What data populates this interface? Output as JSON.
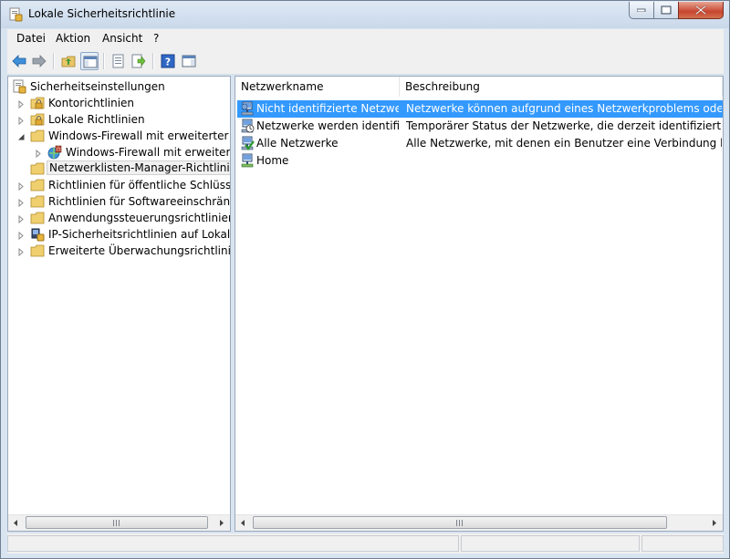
{
  "window": {
    "title": "Lokale Sicherheitsrichtlinie"
  },
  "menu": {
    "items": [
      "Datei",
      "Aktion",
      "Ansicht",
      "?"
    ]
  },
  "toolbar": {
    "icons": [
      "back-arrow-icon",
      "forward-arrow-icon",
      "up-folder-icon",
      "show-tree-icon",
      "properties-icon",
      "export-list-icon",
      "help-icon",
      "action-pane-icon"
    ]
  },
  "tree": {
    "root": "Sicherheitseinstellungen",
    "items": [
      {
        "label": "Kontorichtlinien",
        "icon": "folder-lock-icon"
      },
      {
        "label": "Lokale Richtlinien",
        "icon": "folder-lock-icon"
      },
      {
        "label": "Windows-Firewall mit erweiterter Sich",
        "icon": "folder-icon"
      },
      {
        "label": "Windows-Firewall mit erweiterter",
        "icon": "firewall-icon"
      },
      {
        "label": "Netzwerklisten-Manager-Richtlinien",
        "icon": "folder-icon"
      },
      {
        "label": "Richtlinien für öffentliche Schlüssel",
        "icon": "folder-icon"
      },
      {
        "label": "Richtlinien für Softwareeinschränkung",
        "icon": "folder-icon"
      },
      {
        "label": "Anwendungssteuerungsrichtlinien",
        "icon": "folder-icon"
      },
      {
        "label": "IP-Sicherheitsrichtlinien auf Lokaler C",
        "icon": "ip-security-icon"
      },
      {
        "label": "Erweiterte Überwachungsrichtlinienko",
        "icon": "folder-icon"
      }
    ]
  },
  "list": {
    "columns": [
      "Netzwerkname",
      "Beschreibung"
    ],
    "rows": [
      {
        "name": "Nicht identifizierte Netzwerke",
        "desc": "Netzwerke können aufgrund eines Netzwerkproblems oder aufgru",
        "icon": "network-unknown-icon"
      },
      {
        "name": "Netzwerke werden identifizi...",
        "desc": "Temporärer Status der Netzwerke, die derzeit identifiziert werden.",
        "icon": "network-identifying-icon"
      },
      {
        "name": "Alle Netzwerke",
        "desc": "Alle Netzwerke, mit denen ein Benutzer eine Verbindung herstellt.",
        "icon": "network-all-icon"
      },
      {
        "name": "Home",
        "desc": "",
        "icon": "network-home-icon"
      }
    ]
  },
  "colors": {
    "selection": "#3399ff",
    "frame": "#d9e4f1"
  }
}
